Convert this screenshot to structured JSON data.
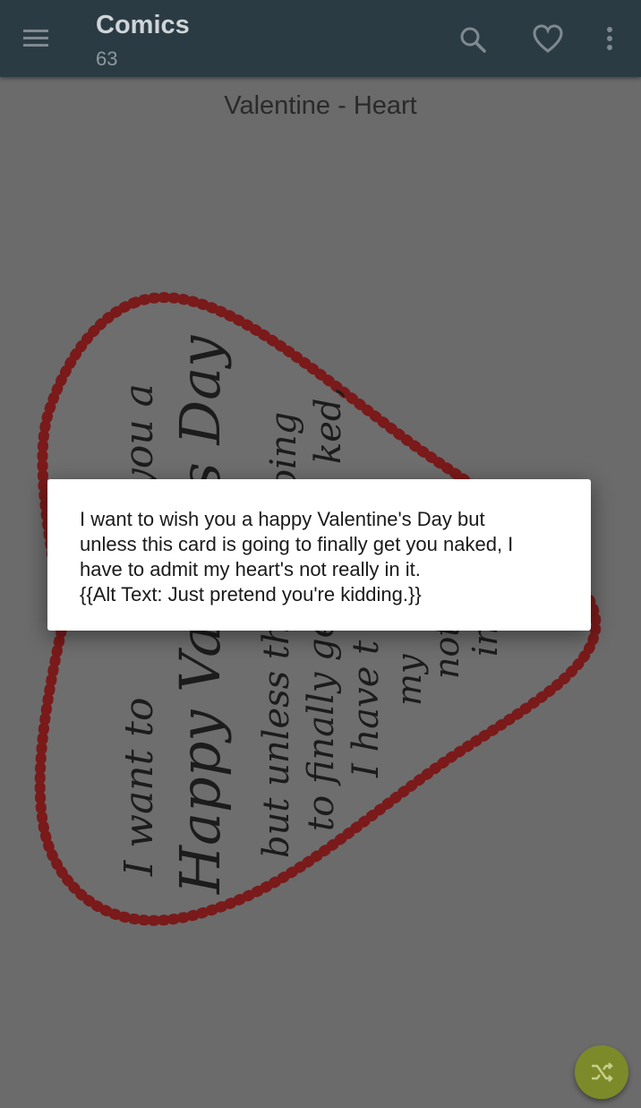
{
  "app_bar": {
    "title": "Comics",
    "subtitle": "63",
    "icons": [
      "menu-icon",
      "search-icon",
      "heart-icon",
      "more-vert-icon"
    ]
  },
  "comic": {
    "title": "Valentine - Heart",
    "image_text": [
      "I want to",
      "you a",
      "Happy Vale",
      "s Day",
      "but unless thi",
      "oing",
      "ked,",
      "to finally ge",
      "I have t",
      "my",
      "not",
      "in"
    ]
  },
  "dialog": {
    "lines": [
      "I want to wish you a happy Valentine's Day but",
      "unless this card is going to finally get you naked, I",
      "have to admit my heart's not really in it.",
      "{{Alt Text: Just pretend you're kidding.}}"
    ]
  },
  "fab": {
    "icon": "shuffle-icon"
  },
  "colors": {
    "app_bar": "#2b3b44",
    "scrim": "#6b6b6b",
    "fab": "#7d8a2a",
    "heart_outline": "#7a1a1a"
  }
}
